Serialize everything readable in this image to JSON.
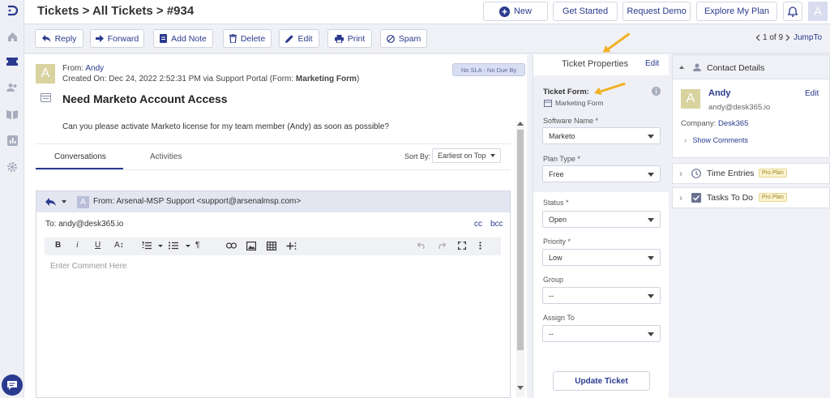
{
  "topbar": {
    "breadcrumb": "Tickets > All Tickets > #934",
    "new_label": "New",
    "get_started_label": "Get Started",
    "request_demo_label": "Request Demo",
    "explore_plan_label": "Explore My Plan",
    "user_initial": "A"
  },
  "toolbar": {
    "reply": "Reply",
    "forward": "Forward",
    "add_note": "Add Note",
    "delete": "Delete",
    "edit": "Edit",
    "print": "Print",
    "spam": "Spam",
    "pager": "1 of 9",
    "jump_to": "JumpTo"
  },
  "ticket": {
    "avatar": "A",
    "from_label": "From:",
    "from_name": "Andy",
    "created_prefix": "Created On: Dec 24, 2022 2:52:31 PM via Support Portal (Form: ",
    "form_name": "Marketing Form",
    "created_suffix": ")",
    "sla": "No SLA - No Due By",
    "subject": "Need Marketo Account Access",
    "body": "Can you please activate Marketo license for my team member (Andy) as soon as possible?"
  },
  "tabs": {
    "conversations": "Conversations",
    "activities": "Activities",
    "sort_label": "Sort By:",
    "sort_value": "Earliest on Top"
  },
  "reply": {
    "avatar": "A",
    "from": "From: Arsenal-MSP Support <support@arsenalmsp.com>",
    "to": "To: andy@desk365.io",
    "cc": "cc",
    "bcc": "bcc",
    "placeholder": "Enter Comment Here",
    "fmt": {
      "bold": "B",
      "italic": "i",
      "underline": "U",
      "fontsize": "A↕",
      "paragraph": "¶"
    }
  },
  "properties": {
    "title": "Ticket Properties",
    "edit": "Edit",
    "form_label": "Ticket Form:",
    "form_value": "Marketing Form",
    "software_label": "Software Name",
    "software_value": "Marketo",
    "plan_label": "Plan Type",
    "plan_value": "Free",
    "status_label": "Status",
    "status_value": "Open",
    "priority_label": "Priority",
    "priority_value": "Low",
    "group_label": "Group",
    "group_value": "--",
    "assign_label": "Assign To",
    "assign_value": "--",
    "required_mark": "*",
    "update_button": "Update Ticket"
  },
  "contact": {
    "header": "Contact Details",
    "avatar": "A",
    "name": "Andy",
    "edit": "Edit",
    "email": "andy@desk365.io",
    "company_label": "Company:",
    "company": "Desk365",
    "show_comments": "Show Comments",
    "time_entries": "Time Entries",
    "tasks": "Tasks To Do",
    "pro_plan": "Pro Plan"
  },
  "colors": {
    "accent": "#2a3a8e",
    "arrow": "#f2b021",
    "avatar": "#d9d3a0"
  }
}
